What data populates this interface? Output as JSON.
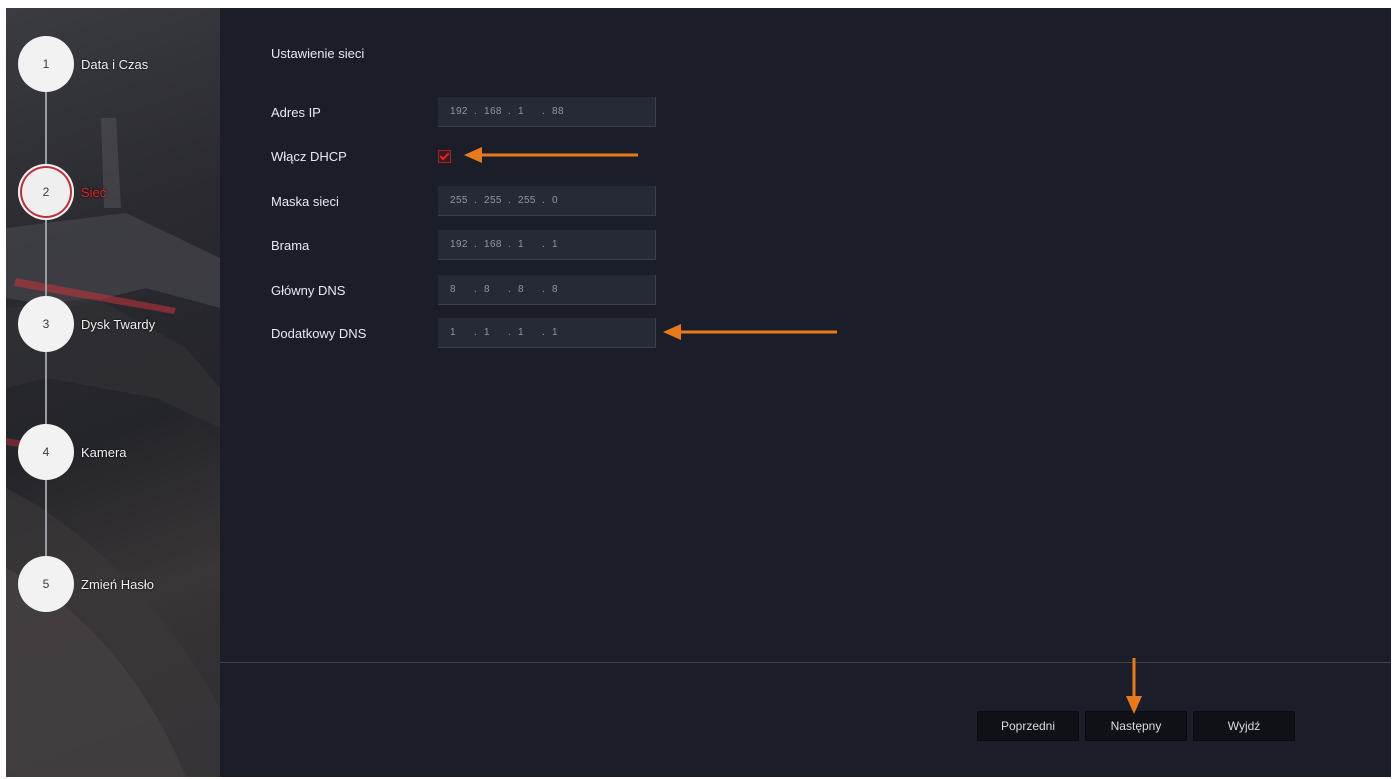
{
  "wizard": {
    "steps": [
      {
        "number": "1",
        "label": "Data i Czas"
      },
      {
        "number": "2",
        "label": "Sieć"
      },
      {
        "number": "3",
        "label": "Dysk Twardy"
      },
      {
        "number": "4",
        "label": "Kamera"
      },
      {
        "number": "5",
        "label": "Zmień Hasło"
      }
    ],
    "active_step": 2
  },
  "network": {
    "title": "Ustawienie sieci",
    "ip_address": {
      "label": "Adres IP",
      "octets": [
        "192",
        "168",
        "1",
        "88"
      ]
    },
    "dhcp": {
      "label": "Włącz DHCP",
      "checked": true
    },
    "subnet_mask": {
      "label": "Maska sieci",
      "octets": [
        "255",
        "255",
        "255",
        "0"
      ]
    },
    "gateway": {
      "label": "Brama",
      "octets": [
        "192",
        "168",
        "1",
        "1"
      ]
    },
    "primary_dns": {
      "label": "Główny DNS",
      "octets": [
        "8",
        "8",
        "8",
        "8"
      ]
    },
    "secondary_dns": {
      "label": "Dodatkowy DNS",
      "octets": [
        "1",
        "1",
        "1",
        "1"
      ]
    }
  },
  "buttons": {
    "previous": "Poprzedni",
    "next": "Następny",
    "exit": "Wyjdź"
  },
  "colors": {
    "background": "#1b1e29",
    "field": "#262a37",
    "active_step": "#e02424",
    "annotation_arrow": "#e87a1e",
    "button": "#0f1117"
  }
}
